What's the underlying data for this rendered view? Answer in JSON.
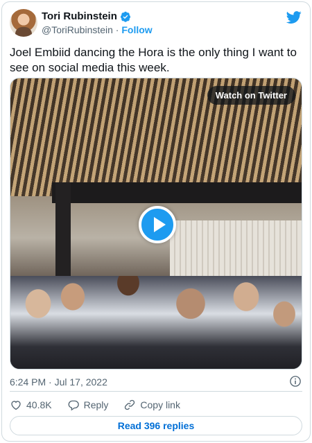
{
  "author": {
    "name": "Tori Rubinstein",
    "handle": "@ToriRubinstein",
    "separator": " · ",
    "follow_label": "Follow"
  },
  "tweet": {
    "text": "Joel Embiid dancing the Hora is the only thing I want to see on social media this week."
  },
  "media": {
    "watch_label": "Watch on Twitter"
  },
  "meta": {
    "timestamp": "6:24 PM · Jul 17, 2022"
  },
  "actions": {
    "likes": "40.8K",
    "reply_label": "Reply",
    "copy_link_label": "Copy link",
    "read_replies_label": "Read 396 replies"
  },
  "colors": {
    "accent": "#1d9bf0",
    "like_red": "#f91880",
    "text_secondary": "#536471"
  }
}
